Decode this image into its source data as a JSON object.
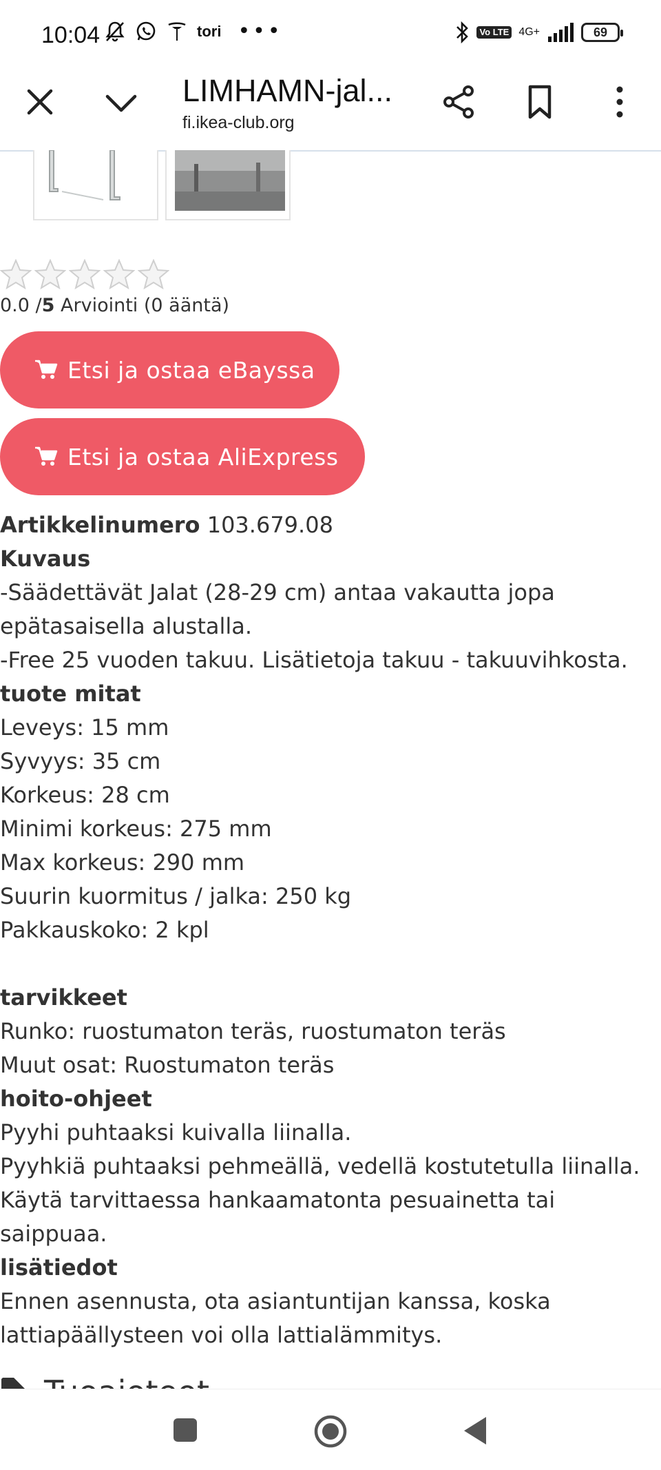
{
  "status_bar": {
    "time": "10:04",
    "app_label": "tori",
    "overflow": "•••",
    "network": "4G+",
    "volte": "Vo LTE",
    "battery": "69"
  },
  "browser": {
    "title": "LIMHAMN-jal...",
    "url": "fi.ikea-club.org"
  },
  "rating": {
    "score": "0.0",
    "max": "5",
    "label": "Arviointi (0 ääntä)",
    "stars_filled": 0
  },
  "buttons": {
    "ebay": "Etsi ja ostaa eBayssa",
    "aliexpress": "Etsi ja ostaa AliExpress"
  },
  "article": {
    "label": "Artikkelinumero",
    "value": "103.679.08"
  },
  "description": {
    "heading": "Kuvaus",
    "lines": [
      "-Säädettävät Jalat (28-29 cm) antaa vakautta jopa",
      "epätasaisella alustalla.",
      "-Free 25 vuoden takuu. Lisätietoja takuu - takuuvihkosta."
    ]
  },
  "dimensions": {
    "heading": "tuote mitat",
    "lines": [
      "Leveys: 15 mm",
      "Syvyys: 35 cm",
      "Korkeus: 28 cm",
      "Minimi korkeus: 275 mm",
      "Max korkeus: 290 mm",
      "Suurin kuormitus / jalka: 250 kg",
      "Pakkauskoko: 2 kpl"
    ]
  },
  "materials": {
    "heading": "tarvikkeet",
    "lines": [
      "Runko: ruostumaton teräs, ruostumaton teräs",
      "Muut osat: Ruostumaton teräs"
    ]
  },
  "care": {
    "heading": "hoito-ohjeet",
    "lines": [
      "Pyyhi puhtaaksi kuivalla liinalla.",
      "Pyyhkiä puhtaaksi pehmeällä, vedellä kostutetulla liinalla.",
      "Käytä tarvittaessa hankaamatonta pesuainetta tai saippuaa."
    ]
  },
  "extra": {
    "heading": "lisätiedot",
    "lines": [
      "Ennen asennusta, ota asiantuntijan kanssa, koska",
      "lattiapäällysteen voi olla lattialämmitys."
    ]
  },
  "next_section": {
    "heading": "Tuoaioteot"
  },
  "colors": {
    "accent": "#ef5a66",
    "text": "#333333"
  },
  "icons": [
    "close-icon",
    "chevron-down-icon",
    "share-icon",
    "bookmark-icon",
    "more-vert-icon",
    "cart-icon",
    "star-icon",
    "tag-icon",
    "bluetooth-icon",
    "signal-icon",
    "battery-icon"
  ]
}
